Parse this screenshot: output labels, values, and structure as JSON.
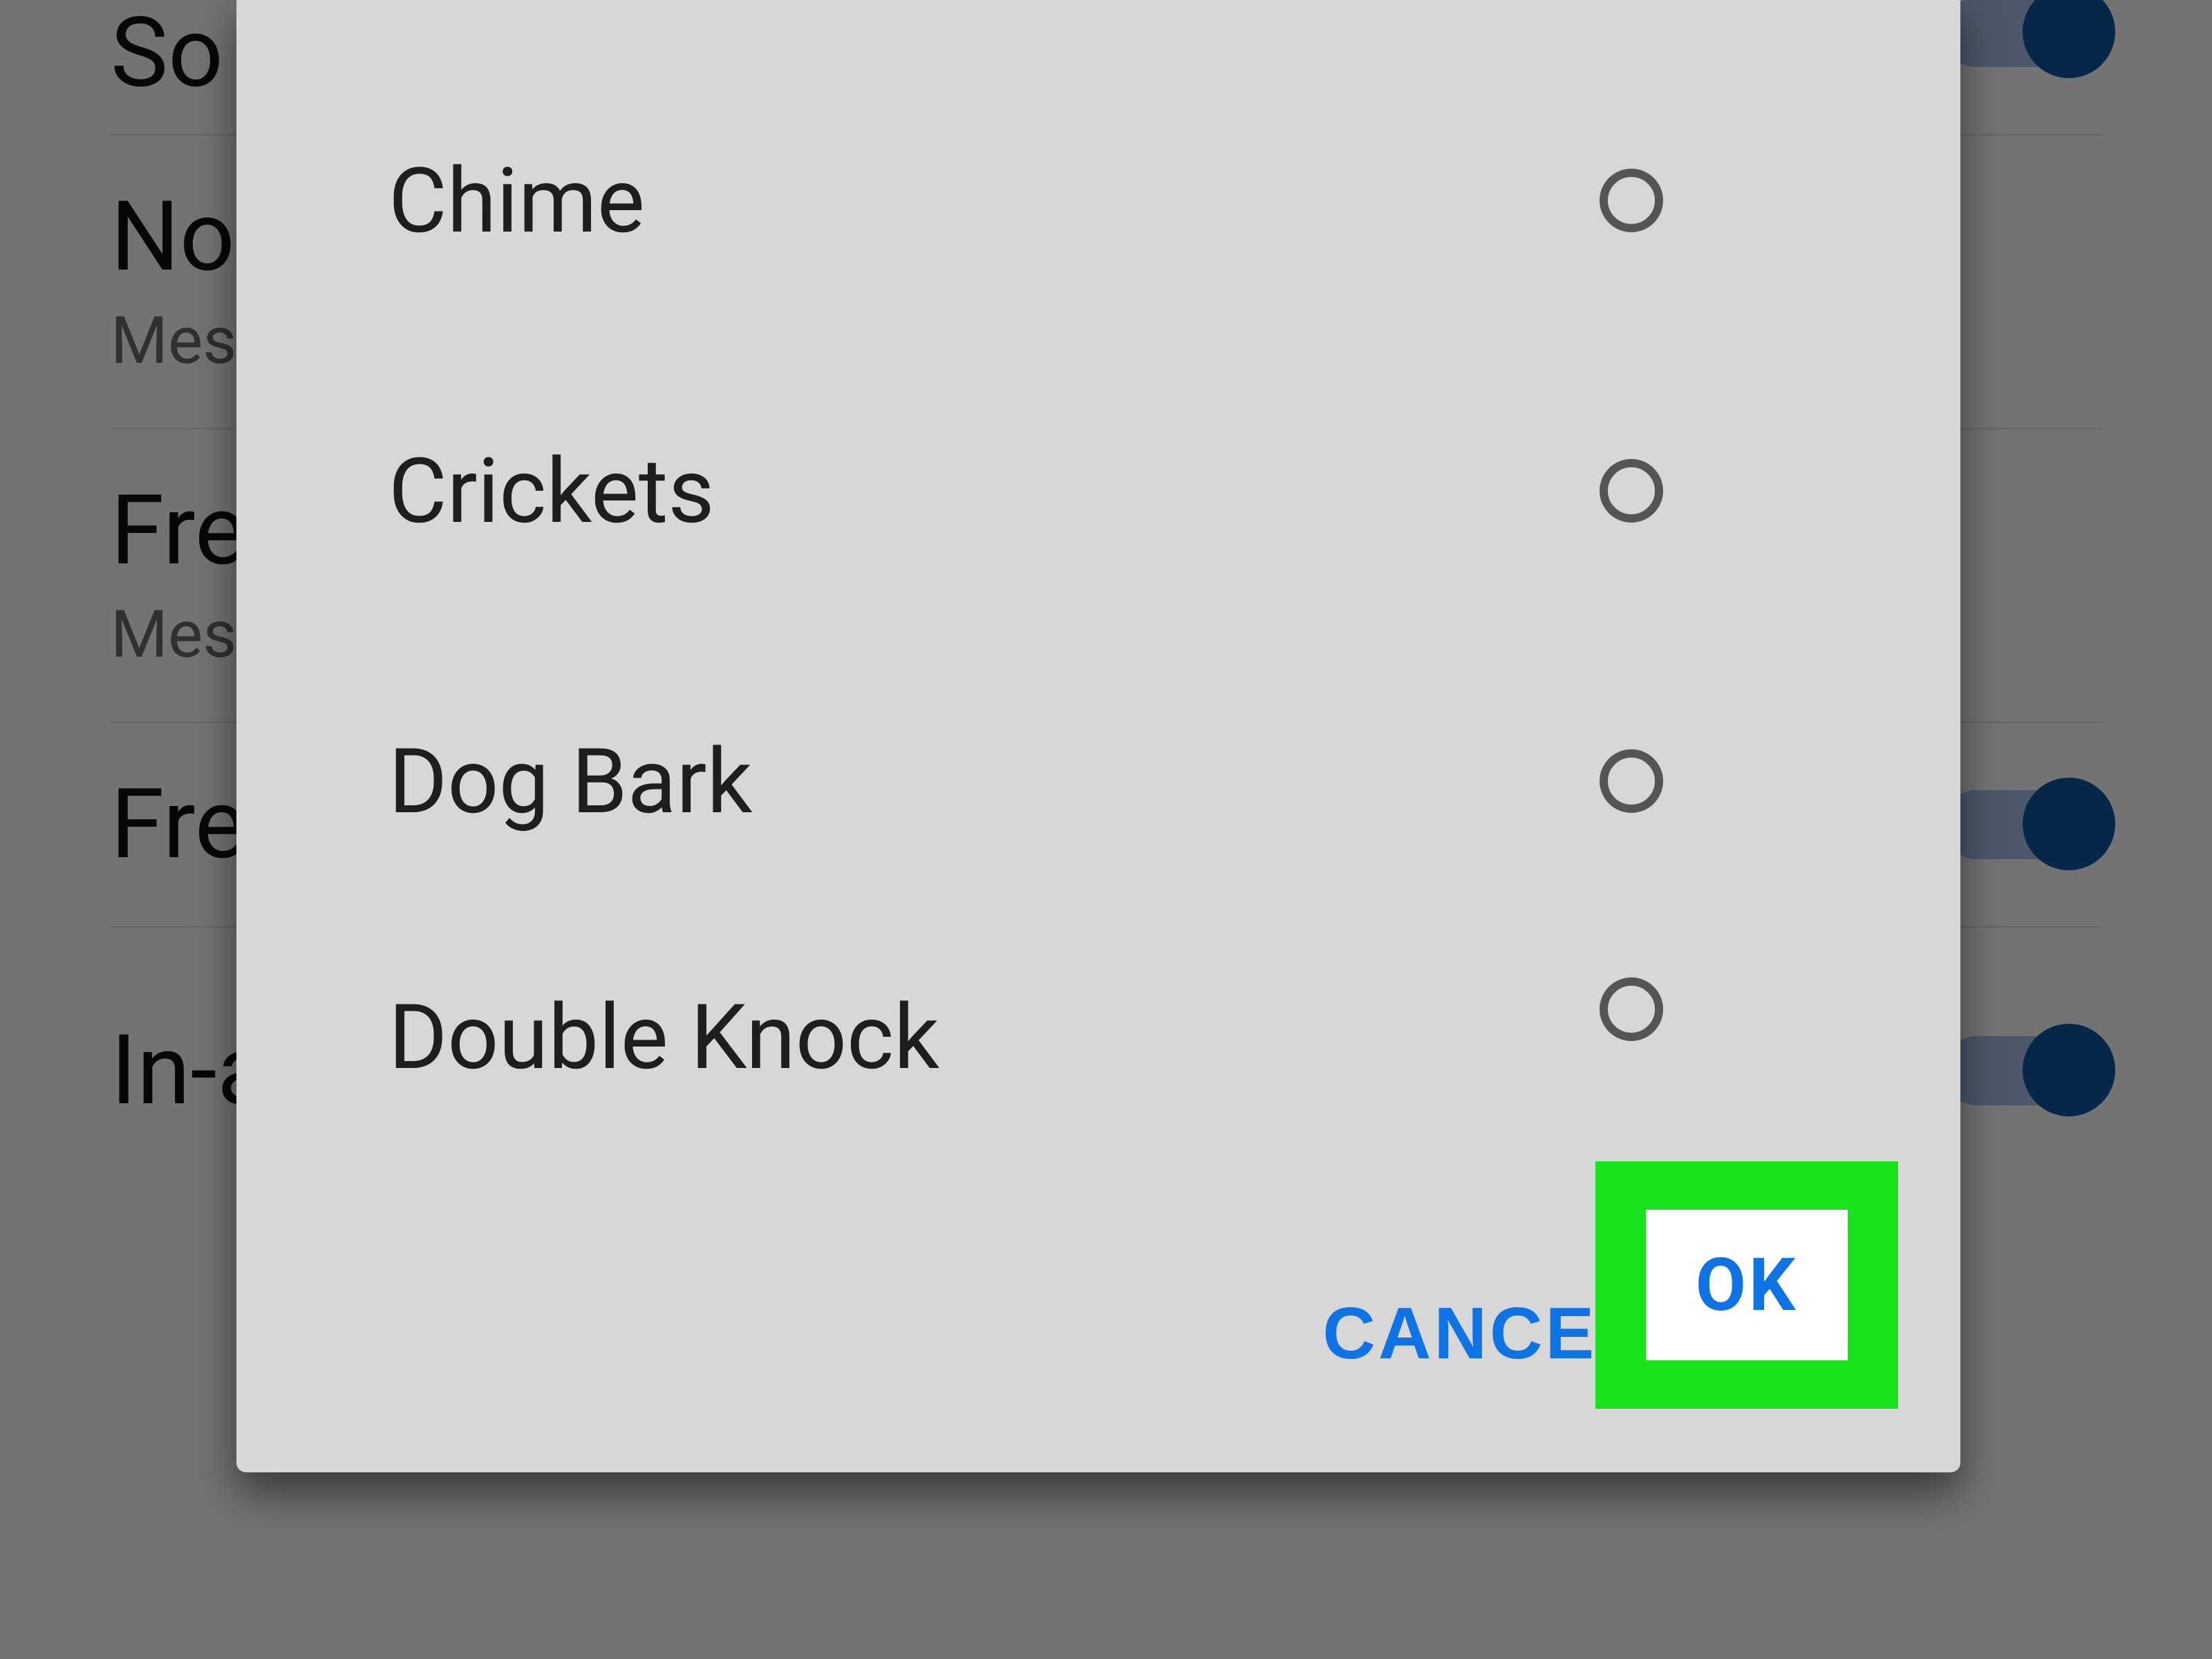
{
  "background": {
    "rows": [
      {
        "title": "So",
        "sub": ""
      },
      {
        "title": "No",
        "sub": "Mes"
      },
      {
        "title": "Fre",
        "sub": "Mes"
      },
      {
        "title": "Fre",
        "sub": ""
      },
      {
        "title": "In-app sounds",
        "sub": ""
      }
    ]
  },
  "dialog": {
    "options": [
      {
        "label": "Chime",
        "selected": false
      },
      {
        "label": "Crickets",
        "selected": false
      },
      {
        "label": "Dog Bark",
        "selected": false
      },
      {
        "label": "Double Knock",
        "selected": false
      }
    ],
    "actions": {
      "cancel_label": "CANCEL",
      "ok_label": "OK"
    }
  },
  "highlight": {
    "target": "ok-button"
  }
}
